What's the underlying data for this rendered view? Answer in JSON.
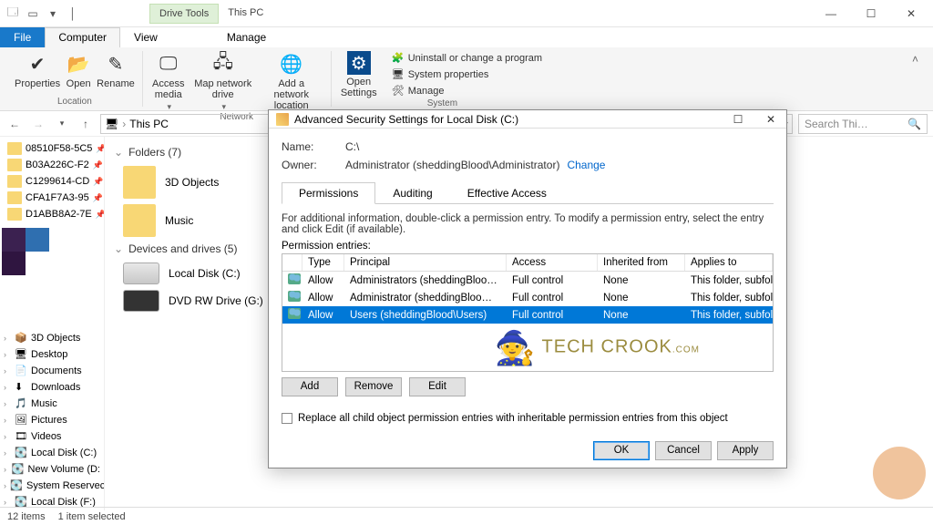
{
  "titlebar": {
    "context_tab": "Drive Tools",
    "title": "This PC",
    "controls": {
      "min": "—",
      "max": "☐",
      "close": "✕"
    }
  },
  "ribtabs": {
    "file": "File",
    "computer": "Computer",
    "view": "View",
    "manage": "Manage"
  },
  "ribbon": {
    "location": {
      "properties": "Properties",
      "open": "Open",
      "rename": "Rename",
      "group": "Location"
    },
    "network": {
      "access": "Access media",
      "map": "Map network drive",
      "add": "Add a network location",
      "group": "Network"
    },
    "system": {
      "open_settings": "Open Settings",
      "uninstall": "Uninstall or change a program",
      "sysprops": "System properties",
      "manage": "Manage",
      "group": "System"
    }
  },
  "addr": {
    "pc_icon": "🖥",
    "crumb": "This PC",
    "refresh": "⟳",
    "search_placeholder": "Search Thi…"
  },
  "nav": {
    "folders": [
      "08510F58-5C5",
      "B03A226C-F2",
      "C1299614-CD",
      "CFA1F7A3-95",
      "D1ABB8A2-7E"
    ],
    "lib": [
      {
        "icon": "📦",
        "label": "3D Objects"
      },
      {
        "icon": "🖥",
        "label": "Desktop"
      },
      {
        "icon": "📄",
        "label": "Documents"
      },
      {
        "icon": "⬇",
        "label": "Downloads"
      },
      {
        "icon": "🎵",
        "label": "Music"
      },
      {
        "icon": "🖼",
        "label": "Pictures"
      },
      {
        "icon": "🎞",
        "label": "Videos"
      },
      {
        "icon": "💽",
        "label": "Local Disk (C:)"
      },
      {
        "icon": "💽",
        "label": "New Volume (D:"
      },
      {
        "icon": "💽",
        "label": "System Reservec"
      },
      {
        "icon": "💽",
        "label": "Local Disk (F:)"
      }
    ]
  },
  "groups": {
    "folders_hdr": "Folders (7)",
    "folders": [
      "3D Objects",
      "Music"
    ],
    "drives_hdr": "Devices and drives (5)",
    "drives": [
      "Local Disk (C:)",
      "DVD RW Drive (G:)"
    ]
  },
  "status": {
    "items": "12 items",
    "sel": "1 item selected"
  },
  "dialog": {
    "title": "Advanced Security Settings for Local Disk (C:)",
    "name_lbl": "Name:",
    "name_val": "C:\\",
    "owner_lbl": "Owner:",
    "owner_val": "Administrator (sheddingBlood\\Administrator)",
    "change": "Change",
    "tabs": {
      "perm": "Permissions",
      "audit": "Auditing",
      "eff": "Effective Access"
    },
    "info": "For additional information, double-click a permission entry. To modify a permission entry, select the entry and click Edit (if available).",
    "entries_lbl": "Permission entries:",
    "cols": {
      "type": "Type",
      "prin": "Principal",
      "acc": "Access",
      "inh": "Inherited from",
      "app": "Applies to"
    },
    "rows": [
      {
        "type": "Allow",
        "prin": "Administrators (sheddingBloo…",
        "acc": "Full control",
        "inh": "None",
        "app": "This folder, subfolders and files"
      },
      {
        "type": "Allow",
        "prin": "Administrator (sheddingBloo…",
        "acc": "Full control",
        "inh": "None",
        "app": "This folder, subfolders and files"
      },
      {
        "type": "Allow",
        "prin": "Users (sheddingBlood\\Users)",
        "acc": "Full control",
        "inh": "None",
        "app": "This folder, subfolders and files"
      }
    ],
    "btns": {
      "add": "Add",
      "remove": "Remove",
      "edit": "Edit"
    },
    "replace": "Replace all child object permission entries with inheritable permission entries from this object",
    "footer": {
      "ok": "OK",
      "cancel": "Cancel",
      "apply": "Apply"
    },
    "watermark": "TECH CROOK",
    "watermark_dom": ".COM"
  }
}
